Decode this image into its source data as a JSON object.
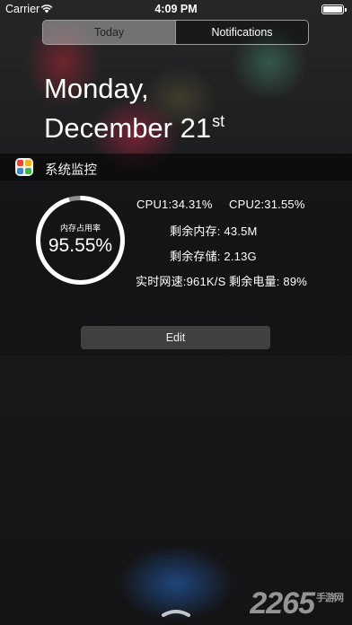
{
  "status_bar": {
    "carrier": "Carrier",
    "time": "4:09 PM",
    "battery_level": 1.0
  },
  "tabs": [
    {
      "label": "Today",
      "selected": true
    },
    {
      "label": "Notifications",
      "selected": false
    }
  ],
  "date": {
    "line1": "Monday,",
    "line2": "December 21",
    "suffix": "st"
  },
  "widget": {
    "title": "系统监控",
    "icon": "system-monitor-app-icon",
    "ring": {
      "caption": "内存占用率",
      "value_text": "95.55%",
      "fraction": 0.9555,
      "color": "#ffffff",
      "track_color": "#8e8e8e"
    },
    "stats": {
      "cpu1": "CPU1:34.31%",
      "cpu2": "CPU2:31.55%",
      "free_memory": "剩余内存: 43.5M",
      "free_storage": "剩余存储: 2.13G",
      "network_speed": "实时网速:961K/S",
      "battery": "剩余电量: 89%"
    }
  },
  "edit_button": {
    "label": "Edit"
  },
  "watermark": {
    "text": "2265",
    "sub": "手游网"
  },
  "icons": {
    "wifi": "wifi-icon",
    "battery": "battery-icon",
    "handle": "chevron-up-icon"
  }
}
